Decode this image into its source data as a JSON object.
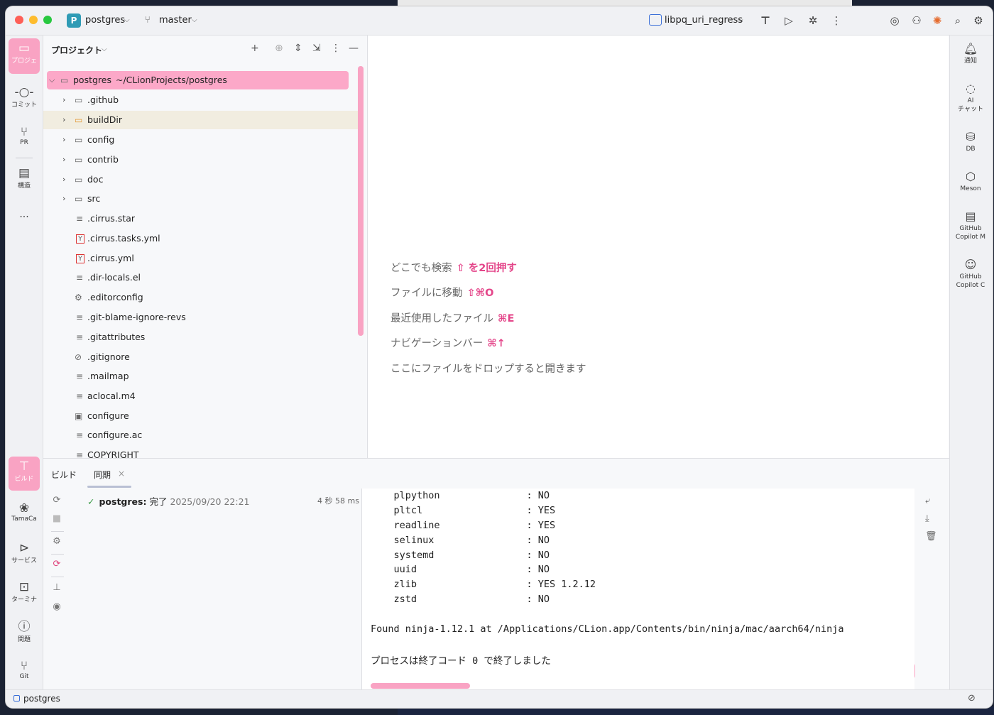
{
  "titlebar": {
    "project_badge": "P",
    "project_name": "postgres",
    "branch": "master",
    "run_config": "libpq_uri_regress"
  },
  "left_stripe": [
    {
      "icon": "folder-icon",
      "label": "プロジェ"
    },
    {
      "icon": "commit-icon",
      "label": "コミット"
    },
    {
      "icon": "pull-request-icon",
      "label": "PR"
    },
    {
      "icon": "structure-icon",
      "label": "構造"
    },
    {
      "icon": "more-icon",
      "label": "..."
    },
    {
      "icon": "build-icon",
      "label": "ビルド"
    },
    {
      "icon": "tamacat-icon",
      "label": "TamaCa"
    },
    {
      "icon": "services-icon",
      "label": "サービス"
    },
    {
      "icon": "terminal-icon",
      "label": "ターミナ"
    },
    {
      "icon": "problems-icon",
      "label": "問題"
    },
    {
      "icon": "git-icon",
      "label": "Git"
    }
  ],
  "right_stripe": [
    {
      "icon": "notifications-icon",
      "label": "通知"
    },
    {
      "icon": "ai-chat-icon",
      "label": "AI\nチャット"
    },
    {
      "icon": "database-icon",
      "label": "DB"
    },
    {
      "icon": "meson-icon",
      "label": "Meson"
    },
    {
      "icon": "copilot-icon",
      "label": "GitHub\nCopilot M"
    },
    {
      "icon": "copilot-chat-icon",
      "label": "GitHub\nCopilot C"
    }
  ],
  "project_panel": {
    "title": "プロジェクト",
    "root_name": "postgres",
    "root_path": "~/CLionProjects/postgres",
    "items": [
      {
        "name": ".github",
        "type": "folder"
      },
      {
        "name": "buildDir",
        "type": "folder-orange"
      },
      {
        "name": "config",
        "type": "folder"
      },
      {
        "name": "contrib",
        "type": "folder"
      },
      {
        "name": "doc",
        "type": "folder"
      },
      {
        "name": "src",
        "type": "folder"
      },
      {
        "name": ".cirrus.star",
        "type": "text"
      },
      {
        "name": ".cirrus.tasks.yml",
        "type": "yml"
      },
      {
        "name": ".cirrus.yml",
        "type": "yml"
      },
      {
        "name": ".dir-locals.el",
        "type": "text"
      },
      {
        "name": ".editorconfig",
        "type": "gear"
      },
      {
        "name": ".git-blame-ignore-revs",
        "type": "text"
      },
      {
        "name": ".gitattributes",
        "type": "text"
      },
      {
        "name": ".gitignore",
        "type": "ignore"
      },
      {
        "name": ".mailmap",
        "type": "text"
      },
      {
        "name": "aclocal.m4",
        "type": "text"
      },
      {
        "name": "configure",
        "type": "script"
      },
      {
        "name": "configure.ac",
        "type": "text"
      },
      {
        "name": "COPYRIGHT",
        "type": "text"
      }
    ]
  },
  "editor_hints": [
    {
      "text": "どこでも検索",
      "key": "⇧ を2回押す"
    },
    {
      "text": "ファイルに移動",
      "key": "⇧⌘O"
    },
    {
      "text": "最近使用したファイル",
      "key": "⌘E"
    },
    {
      "text": "ナビゲーションバー",
      "key": "⌘↑"
    },
    {
      "text": "ここにファイルをドロップすると開きます",
      "key": ""
    }
  ],
  "build": {
    "tab_build": "ビルド",
    "tab_sync": "同期",
    "status_name": "postgres:",
    "status_text": "完了",
    "status_time": "2025/09/20 22:21",
    "duration": "4 秒 58 ms",
    "console_lines": [
      "    plpython               : NO",
      "    pltcl                  : YES",
      "    readline               : YES",
      "    selinux                : NO",
      "    systemd                : NO",
      "    uuid                   : NO",
      "    zlib                   : YES 1.2.12",
      "    zstd                   : NO",
      "",
      "Found ninja-1.12.1 at /Applications/CLion.app/Contents/bin/ninja/mac/aarch64/ninja",
      "",
      "プロセスは終了コード 0 で終了しました"
    ]
  },
  "statusbar": {
    "project": "postgres"
  }
}
